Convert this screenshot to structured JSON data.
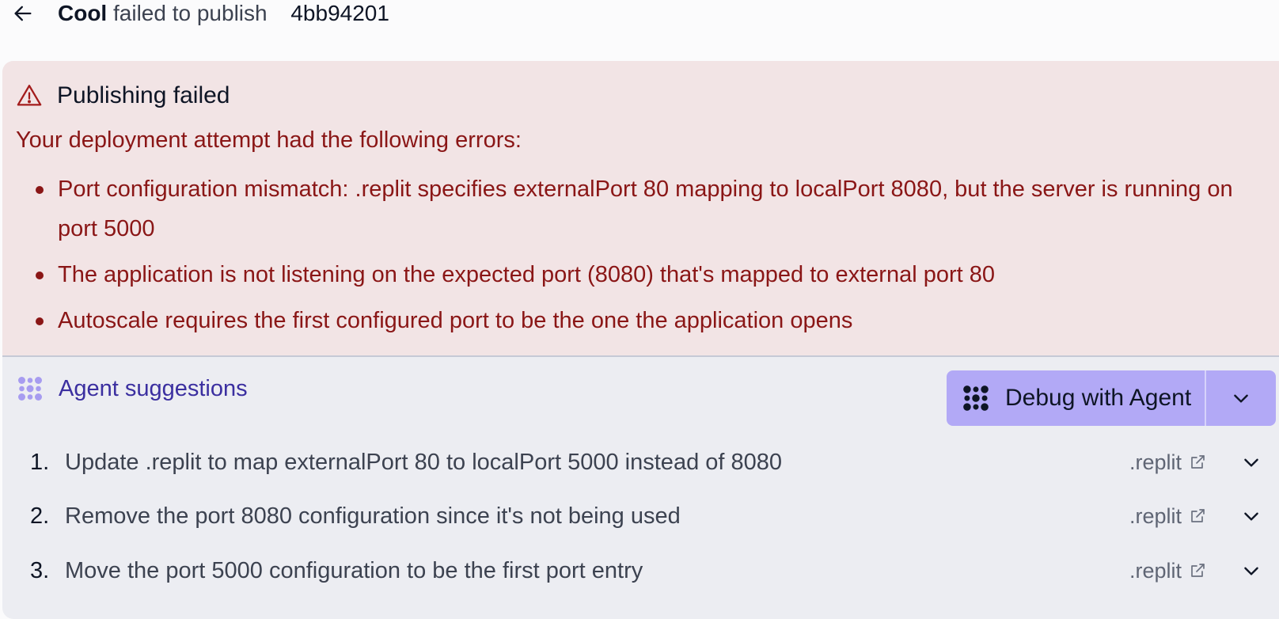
{
  "header": {
    "app_name": "Cool",
    "status_text": "failed to publish",
    "commit_id": "4bb94201"
  },
  "error": {
    "title": "Publishing failed",
    "intro": "Your deployment attempt had the following errors:",
    "items": [
      "Port configuration mismatch: .replit specifies externalPort 80 mapping to localPort 8080, but the server is running on port 5000",
      "The application is not listening on the expected port (8080) that's mapped to external port 80",
      "Autoscale requires the first configured port to be the one the application opens"
    ],
    "color": "#8a1616",
    "background": "#f2e4e5"
  },
  "suggestions": {
    "title": "Agent suggestions",
    "debug_button_label": "Debug with Agent",
    "accent": "#b2a9f6",
    "items": [
      {
        "number": "1.",
        "text": "Update .replit to map externalPort 80 to localPort 5000 instead of 8080",
        "file": ".replit"
      },
      {
        "number": "2.",
        "text": "Remove the port 8080 configuration since it's not being used",
        "file": ".replit"
      },
      {
        "number": "3.",
        "text": "Move the port 5000 configuration to be the first port entry",
        "file": ".replit"
      }
    ]
  },
  "icons": {
    "back": "arrow-left-icon",
    "warning": "warning-triangle-icon",
    "agent": "agent-icon",
    "chevron": "chevron-down-icon",
    "external": "external-link-icon"
  }
}
